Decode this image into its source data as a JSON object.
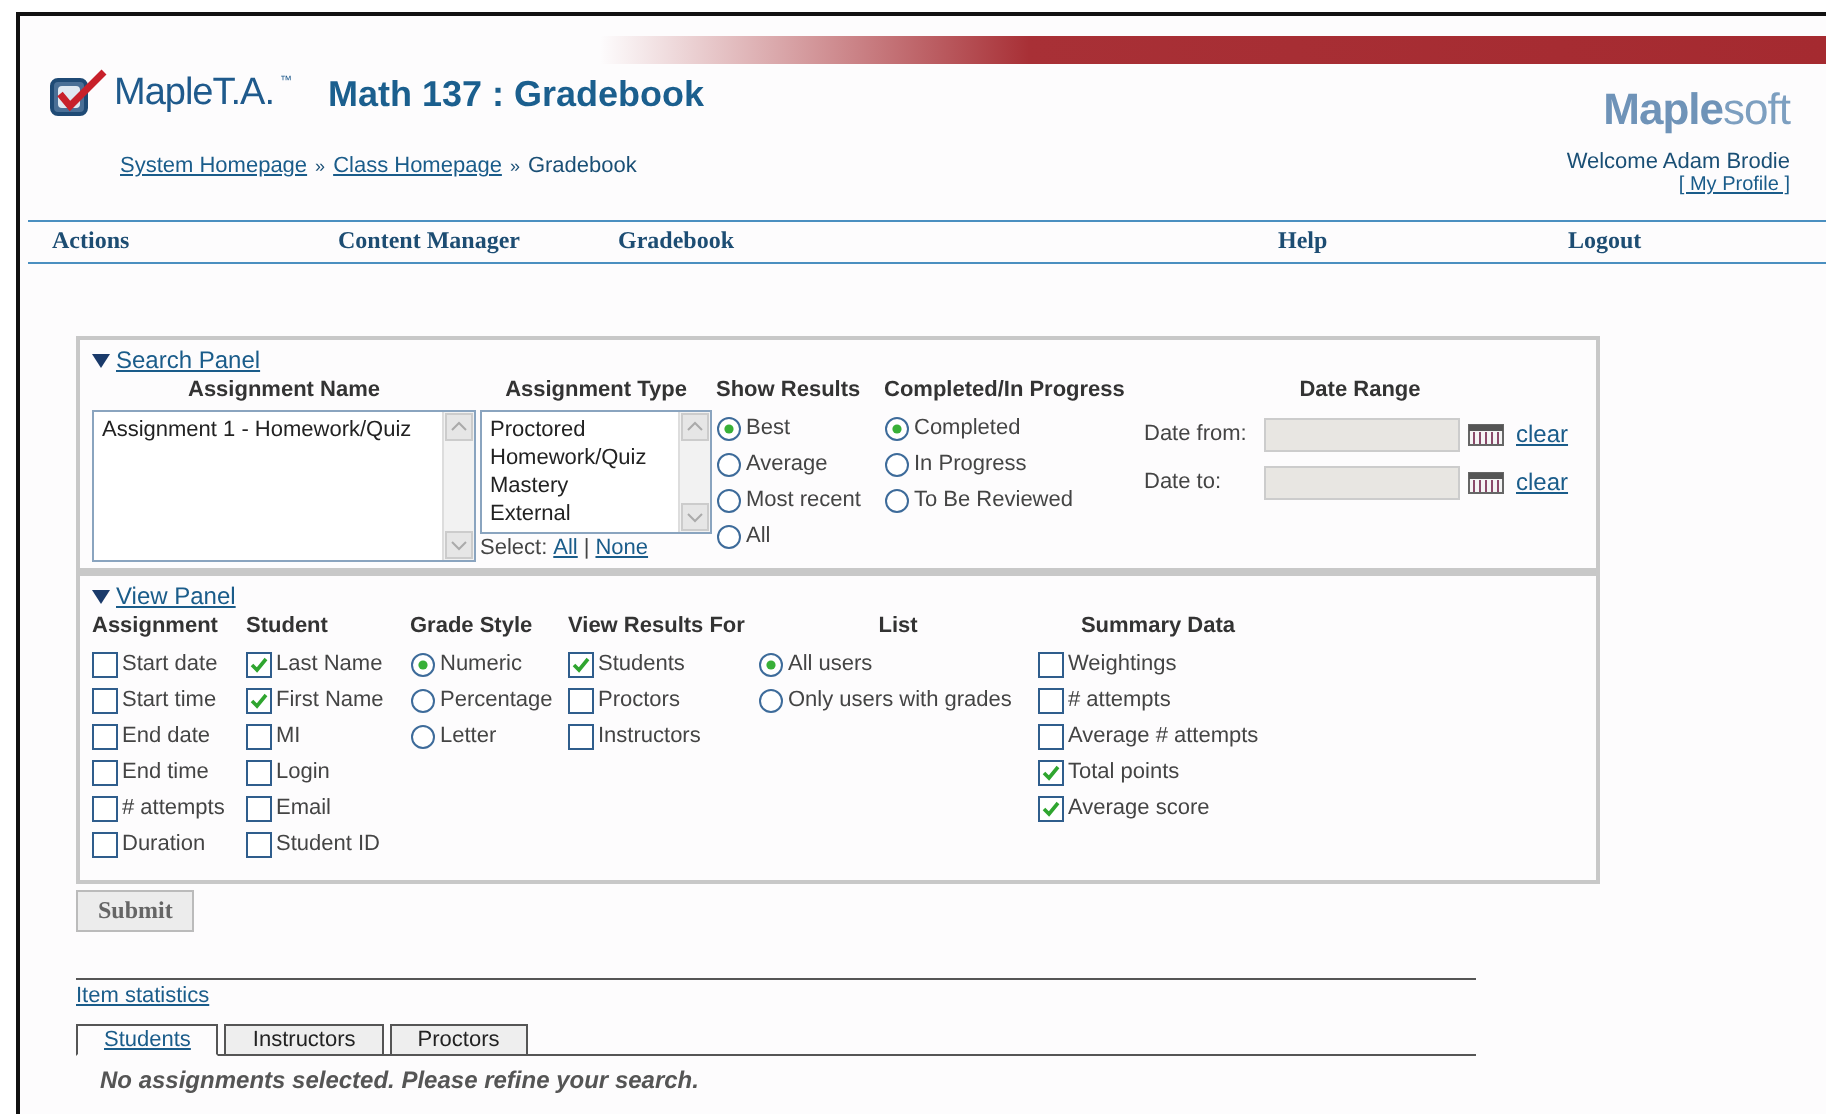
{
  "header": {
    "product": "MapleT.A.",
    "trademark": "™",
    "title": "Math 137 : Gradebook",
    "breadcrumbs": [
      {
        "label": "System Homepage",
        "kind": "link"
      },
      {
        "label": "»",
        "kind": "separator"
      },
      {
        "label": "Class Homepage",
        "kind": "link"
      },
      {
        "label": "»",
        "kind": "separator"
      },
      {
        "label": "Gradebook",
        "kind": "text"
      }
    ],
    "company": "**Maple**soft",
    "welcome": "Welcome Adam Brodie",
    "profile_link": "[ My Profile ]"
  },
  "nav": [
    {
      "label": "Actions"
    },
    {
      "label": "Content Manager"
    },
    {
      "label": "Gradebook"
    },
    {
      "label": "Help"
    },
    {
      "label": "Logout"
    }
  ],
  "search_panel": {
    "title": "Search Panel",
    "assignment_name": {
      "heading": "Assignment Name",
      "options": [
        "Assignment 1 - Homework/Quiz"
      ]
    },
    "assignment_type": {
      "heading": "Assignment Type",
      "options": [
        "Proctored",
        "Homework/Quiz",
        "Mastery",
        "External"
      ],
      "select_label": "Select:",
      "select_links": [
        "All",
        "None"
      ],
      "divider": "|"
    },
    "show_results": {
      "heading": "Show Results",
      "options": [
        {
          "label": "Best",
          "selected": true
        },
        {
          "label": "Average",
          "selected": false
        },
        {
          "label": "Most recent",
          "selected": false
        },
        {
          "label": "All",
          "selected": false
        }
      ]
    },
    "completed": {
      "heading": "Completed/In Progress",
      "options": [
        {
          "label": "Completed",
          "selected": true
        },
        {
          "label": "In Progress",
          "selected": false
        },
        {
          "label": "To Be Reviewed",
          "selected": false
        }
      ]
    },
    "date_range": {
      "heading": "Date Range",
      "fields": [
        {
          "label": "Date from:",
          "clear": "clear"
        },
        {
          "label": "Date to:",
          "clear": "clear"
        }
      ]
    }
  },
  "view_panel": {
    "title": "View Panel",
    "columns": [
      {
        "heading": "Assignment",
        "kind": "checkbox",
        "options": [
          {
            "label": "Start date",
            "checked": false
          },
          {
            "label": "Start time",
            "checked": false
          },
          {
            "label": "End date",
            "checked": false
          },
          {
            "label": "End time",
            "checked": false
          },
          {
            "label": "# attempts",
            "checked": false
          },
          {
            "label": "Duration",
            "checked": false
          }
        ]
      },
      {
        "heading": "Student",
        "kind": "checkbox",
        "options": [
          {
            "label": "Last Name",
            "checked": true
          },
          {
            "label": "First Name",
            "checked": true
          },
          {
            "label": "MI",
            "checked": false
          },
          {
            "label": "Login",
            "checked": false
          },
          {
            "label": "Email",
            "checked": false
          },
          {
            "label": "Student ID",
            "checked": false
          }
        ]
      },
      {
        "heading": "Grade Style",
        "kind": "radio",
        "options": [
          {
            "label": "Numeric",
            "selected": true
          },
          {
            "label": "Percentage",
            "selected": false
          },
          {
            "label": "Letter",
            "selected": false
          }
        ]
      },
      {
        "heading": "View Results For",
        "kind": "checkbox",
        "options": [
          {
            "label": "Students",
            "checked": true
          },
          {
            "label": "Proctors",
            "checked": false
          },
          {
            "label": "Instructors",
            "checked": false
          }
        ]
      },
      {
        "heading": "List",
        "kind": "radio",
        "options": [
          {
            "label": "All users",
            "selected": true
          },
          {
            "label": "Only users with grades",
            "selected": false
          }
        ]
      },
      {
        "heading": "Summary Data",
        "kind": "checkbox",
        "options": [
          {
            "label": "Weightings",
            "checked": false
          },
          {
            "label": "# attempts",
            "checked": false
          },
          {
            "label": "Average # attempts",
            "checked": false
          },
          {
            "label": "Total points",
            "checked": true
          },
          {
            "label": "Average score",
            "checked": true
          }
        ]
      }
    ]
  },
  "submit": "Submit",
  "item_statistics": "Item statistics",
  "tabs": [
    {
      "label": "Students",
      "selected": true
    },
    {
      "label": "Instructors",
      "selected": false
    },
    {
      "label": "Proctors",
      "selected": false
    }
  ],
  "message": "No assignments selected. Please refine your search."
}
